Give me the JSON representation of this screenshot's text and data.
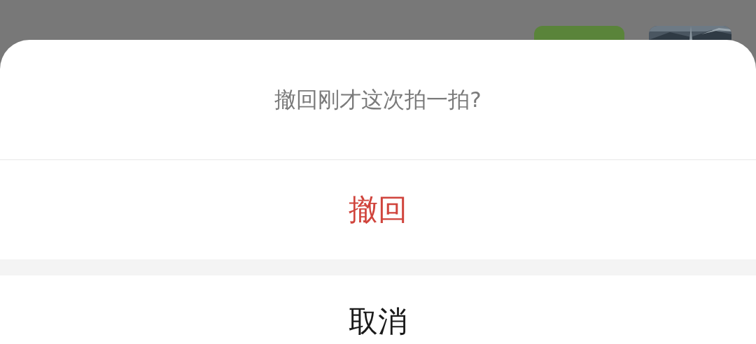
{
  "sheet": {
    "title": "撤回刚才这次拍一拍?",
    "actions": [
      {
        "label": "撤回",
        "kind": "destructive"
      },
      {
        "label": "取消",
        "kind": "cancel"
      }
    ]
  }
}
